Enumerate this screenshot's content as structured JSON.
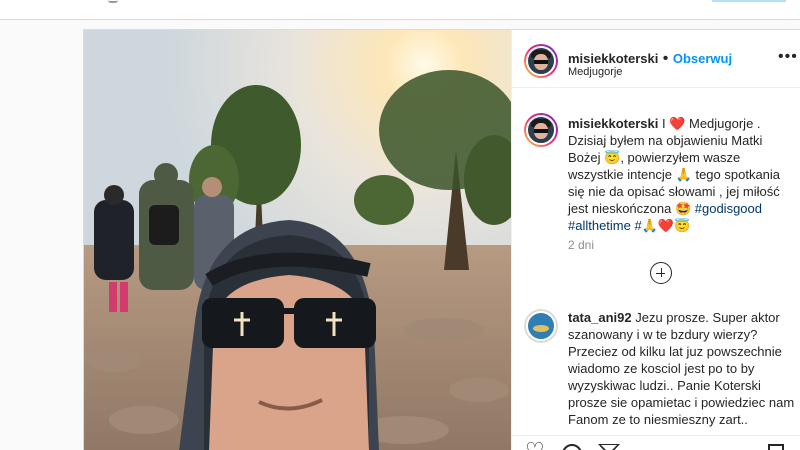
{
  "post": {
    "username": "misiekkoterski",
    "separator": "•",
    "follow_label": "Obserwuj",
    "location": "Medjugorje",
    "more_label": "•••",
    "caption": {
      "username": "misiekkoterski",
      "text_1": " I ",
      "heart_emoji": "❤️",
      "text_2": " Medjugorje . Dzisiaj byłem na objawieniu Matki Bożej ",
      "emoji_smile": "😇",
      "text_3": ", powierzyłem wasze wszystkie intencje ",
      "emoji_pray": "🙏",
      "text_4": " tego spotkania się nie da opisać słowami , jej miłość jest nieskończona ",
      "emoji_star": "🤩",
      "space": " ",
      "hashtag_1": "#godisgood",
      "hashtag_2": "#allthetime",
      "hashtag_3": "#",
      "emoji_tail_1": "🙏",
      "emoji_tail_2": "❤️",
      "emoji_tail_3": "😇"
    },
    "time_ago": "2 dni"
  },
  "comment": {
    "username": "tata_ani92",
    "text": "Jezu prosze. Super aktor szanowany i w te bzdury wierzy? Przeciez od kilku lat juz powszechnie wiadomo ze kosciol jest po to by wyzyskiwac ludzi.. Panie Koterski prosze sie opamietac i powiedziec nam Fanom ze to niesmieszny zart.."
  },
  "icons": {
    "like": "heart-icon",
    "comment": "comment-icon",
    "share": "share-icon",
    "save": "bookmark-icon",
    "more": "more-icon",
    "add": "plus-circle-icon"
  },
  "colors": {
    "follow": "#0095f6",
    "hashtag": "#00376b",
    "muted": "#8e8e8e"
  }
}
